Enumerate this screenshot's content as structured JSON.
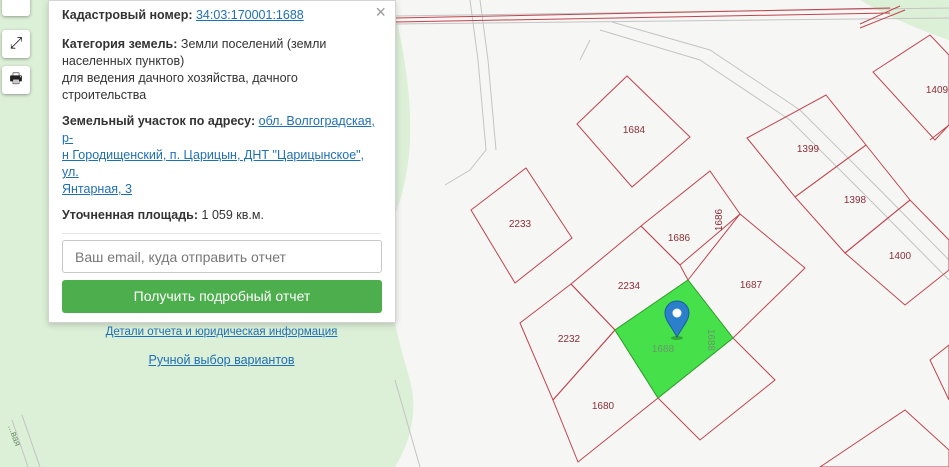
{
  "popup": {
    "cadastral_label": "Кадастровый номер:",
    "cadastral_value": "34:03:170001:1688",
    "category_label": "Категория земель:",
    "category_value_1": "Земли поселений (земли",
    "category_value_2": "населенных пунктов)",
    "category_value_3": "для ведения дачного хозяйства, дачного строительства",
    "address_label": "Земельный участок по адресу:",
    "address_link_1": "обл. Волгоградская, р-",
    "address_link_2": "н Городищенский, п. Царицын, ДНТ \"Царицынское\", ул.",
    "address_link_3": "Янтарная, 3",
    "area_label": "Уточненная площадь:",
    "area_value": "1 059 кв.м.",
    "email_placeholder": "Ваш email, куда отправить отчет",
    "report_button": "Получить подробный отчет",
    "details_link": "Детали отчета и юридическая информация",
    "manual_link": "Ручной выбор вариантов",
    "close_symbol": "×"
  },
  "map": {
    "parcels": [
      "1684",
      "1399",
      "1409",
      "1398",
      "1400",
      "2233",
      "1686",
      "1686",
      "2234",
      "1687",
      "2232",
      "1688",
      "1688",
      "1680"
    ],
    "street_label": "...вая",
    "colors": {
      "boundary": "#c0444e",
      "selected_fill": "#45e04a",
      "forest": "#dcefd7",
      "road_edge": "#bfbfbf",
      "marker": "#2c7fcb"
    }
  },
  "controls": {
    "expand_icon": "⤢",
    "print_icon": "🖶"
  }
}
